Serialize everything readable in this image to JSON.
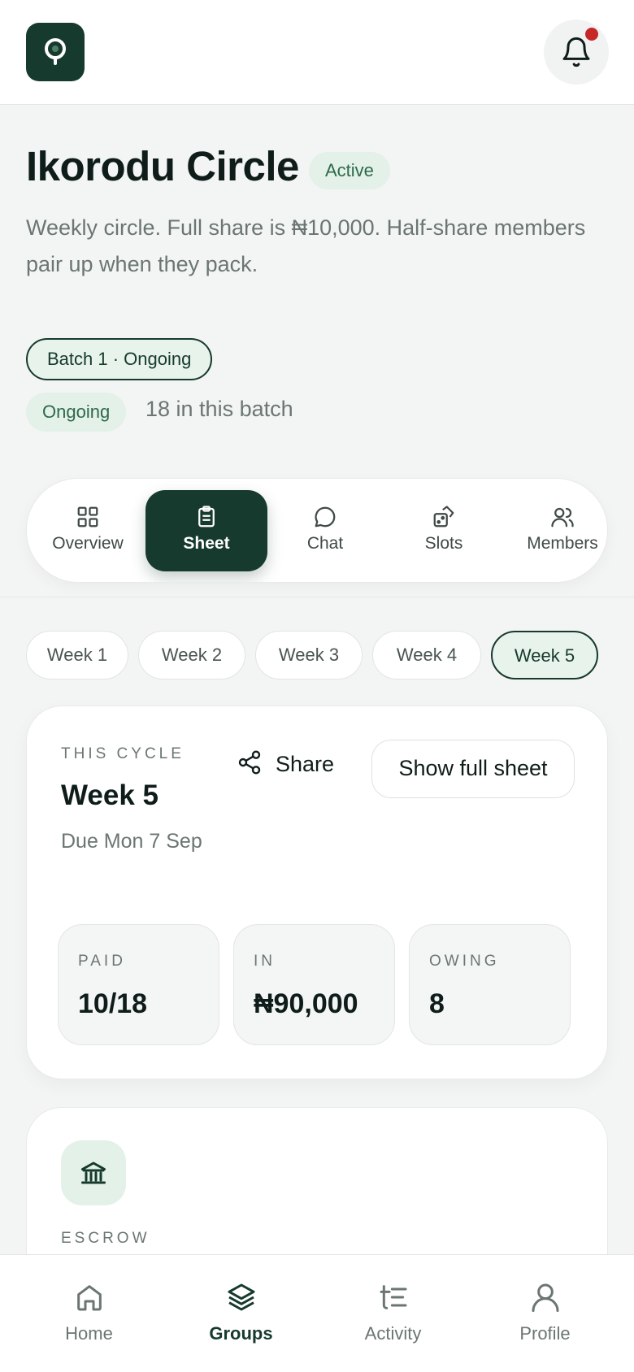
{
  "header": {
    "logo_icon": "app-logo-icon",
    "notification_icon": "bell-icon",
    "has_unread": true
  },
  "group": {
    "title": "Ikorodu Circle",
    "status": "Active",
    "description": "Weekly circle. Full share is ₦10,000. Half-share members pair up when they pack.",
    "batch_label": "Batch 1 · Ongoing",
    "batch_status": "Ongoing",
    "batch_count": "18 in this batch"
  },
  "tabs": [
    {
      "label": "Overview",
      "icon": "grid-icon"
    },
    {
      "label": "Sheet",
      "icon": "clipboard-icon",
      "active": true
    },
    {
      "label": "Chat",
      "icon": "chat-bubble-icon"
    },
    {
      "label": "Slots",
      "icon": "dice-icon"
    },
    {
      "label": "Members",
      "icon": "users-icon"
    }
  ],
  "weeks": [
    "Week 1",
    "Week 2",
    "Week 3",
    "Week 4",
    "Week 5"
  ],
  "selected_week": "Week 5",
  "cycle": {
    "eyebrow": "THIS CYCLE",
    "week": "Week 5",
    "due": "Due Mon 7 Sep",
    "share_label": "Share",
    "full_sheet_label": "Show full sheet",
    "stats": [
      {
        "label": "PAID",
        "value": "10/18"
      },
      {
        "label": "IN",
        "value": "₦90,000"
      },
      {
        "label": "OWING",
        "value": "8"
      }
    ]
  },
  "escrow": {
    "icon": "bank-icon",
    "eyebrow": "ESCROW"
  },
  "bottom_nav": [
    {
      "label": "Home",
      "icon": "home-icon"
    },
    {
      "label": "Groups",
      "icon": "layers-icon",
      "active": true
    },
    {
      "label": "Activity",
      "icon": "activity-list-icon"
    },
    {
      "label": "Profile",
      "icon": "user-icon"
    }
  ],
  "colors": {
    "brand": "#163a2d",
    "accent_bg": "#e3f1e8",
    "notification": "#c62828"
  }
}
